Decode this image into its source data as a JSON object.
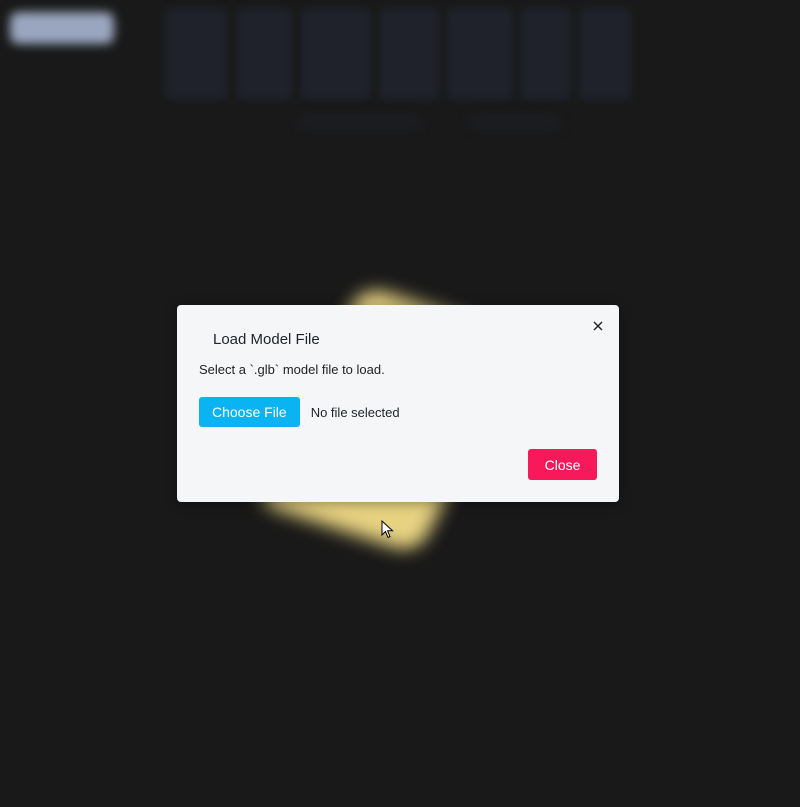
{
  "modal": {
    "title": "Load Model File",
    "description": "Select a `.glb` model file to load.",
    "choose_file_label": "Choose File",
    "file_status": "No file selected",
    "close_label": "Close",
    "close_icon": "close-icon"
  },
  "colors": {
    "background": "#191919",
    "modal_background": "#f5f6f8",
    "choose_file_button": "#0ab4f2",
    "close_button": "#f7195a"
  }
}
